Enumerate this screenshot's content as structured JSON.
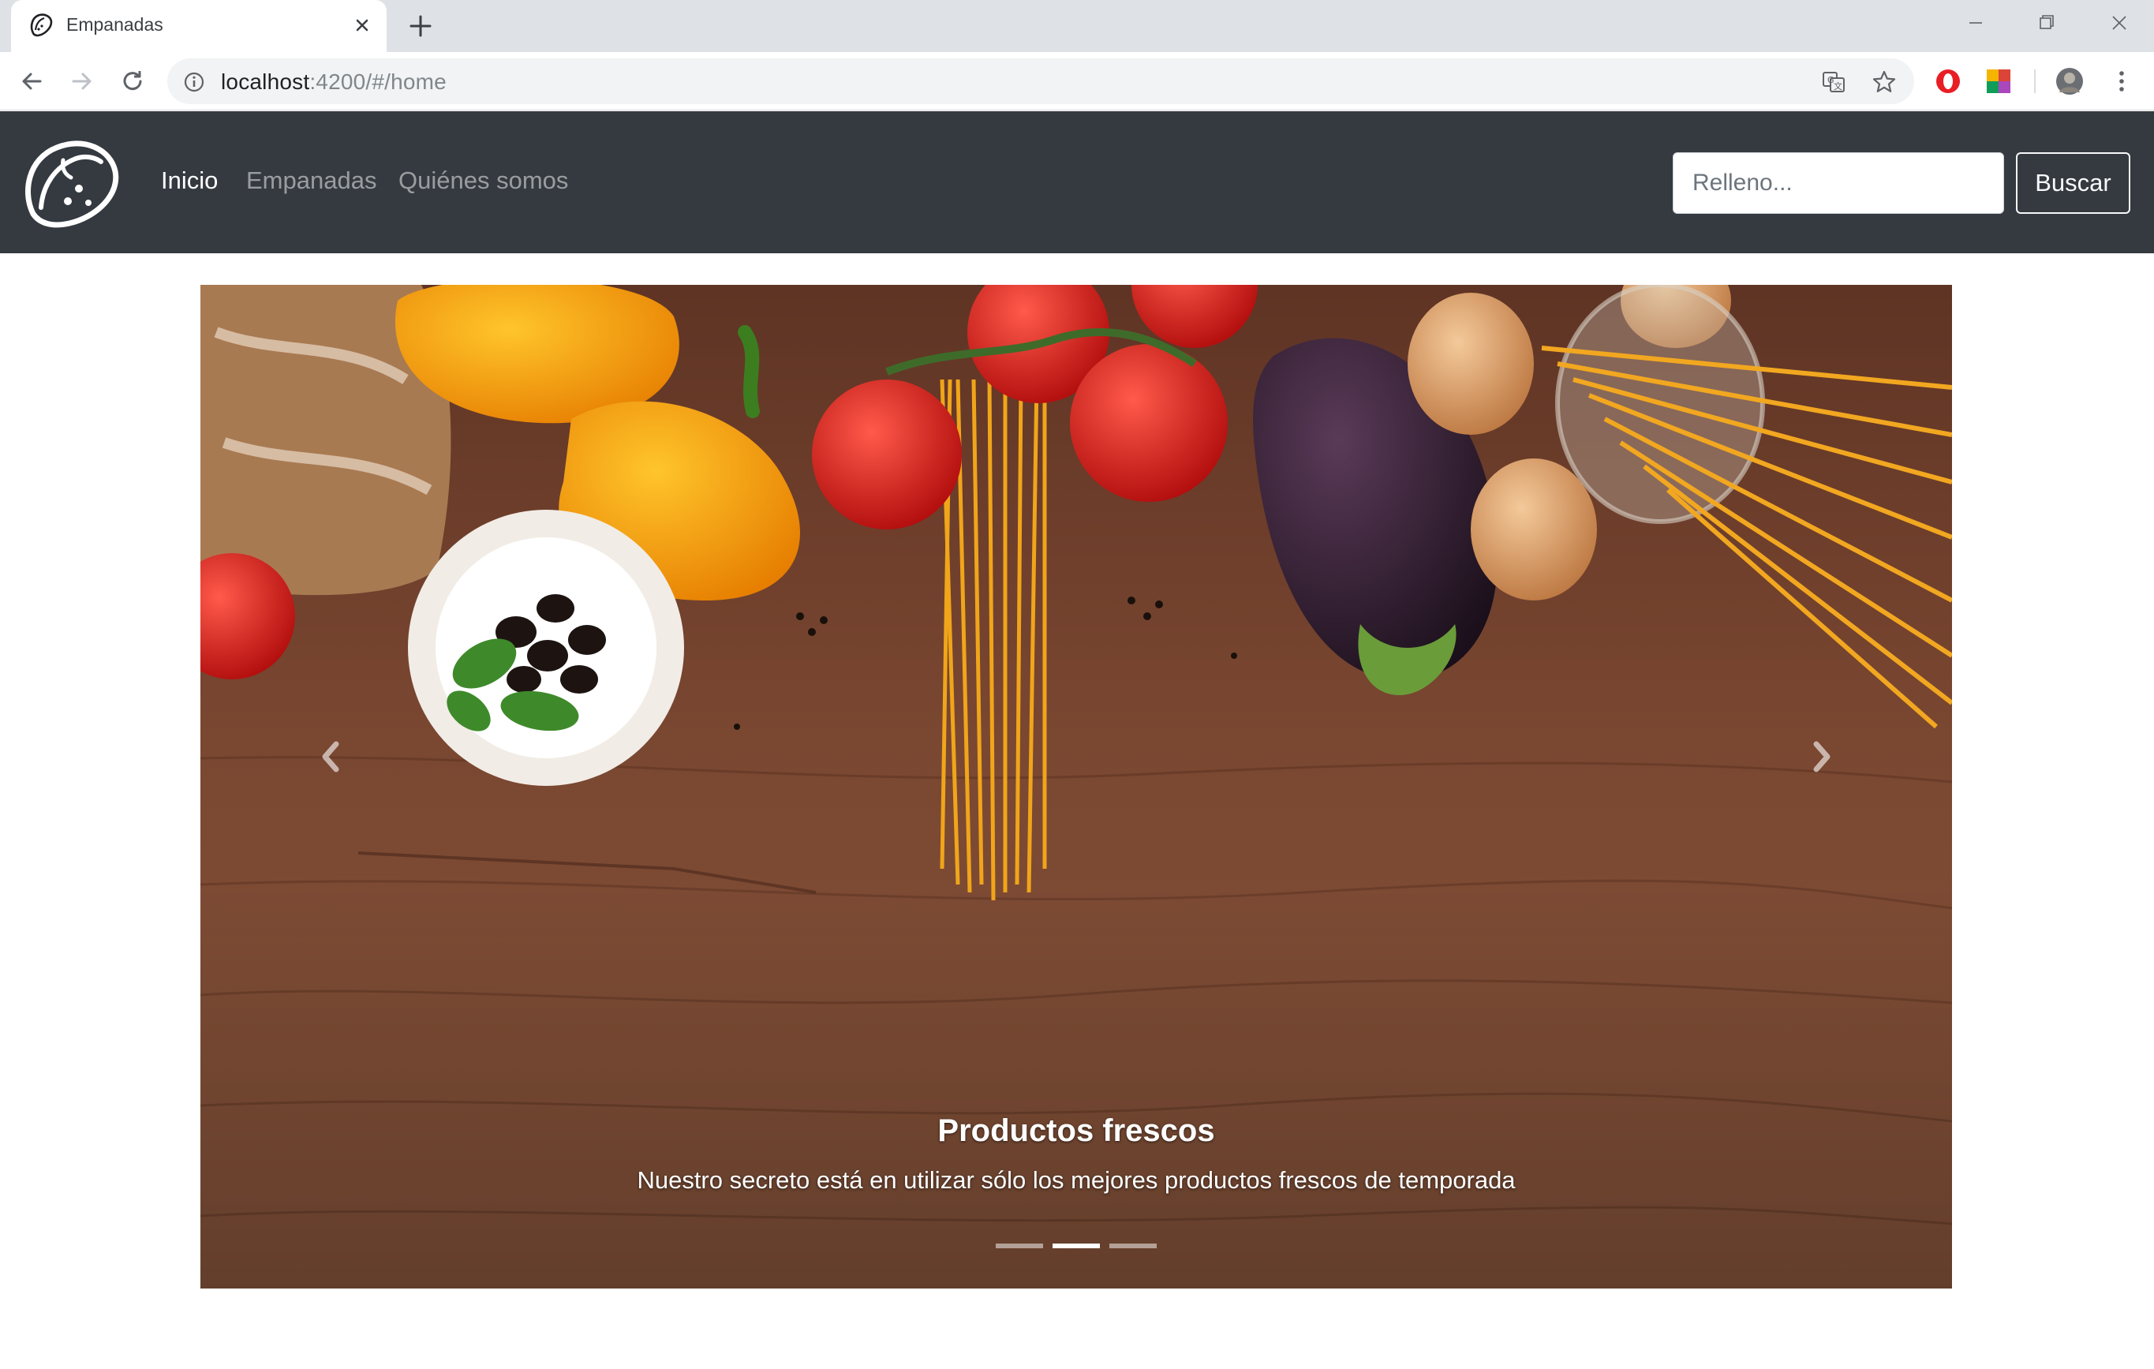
{
  "browser": {
    "tab_title": "Empanadas",
    "url_host": "localhost",
    "url_path": ":4200/#/home"
  },
  "navbar": {
    "links": [
      {
        "label": "Inicio",
        "active": true
      },
      {
        "label": "Empanadas",
        "active": false
      },
      {
        "label": "Quiénes somos",
        "active": false
      }
    ],
    "search_placeholder": "Relleno...",
    "search_button": "Buscar"
  },
  "carousel": {
    "caption_title": "Productos frescos",
    "caption_text": "Nuestro secreto está en utilizar sólo los mejores productos frescos de temporada",
    "slide_count": 3,
    "active_slide": 2
  },
  "colors": {
    "navbar_bg": "#343a40",
    "tabstrip_bg": "#dee1e6",
    "wood": "#7a4a33"
  }
}
